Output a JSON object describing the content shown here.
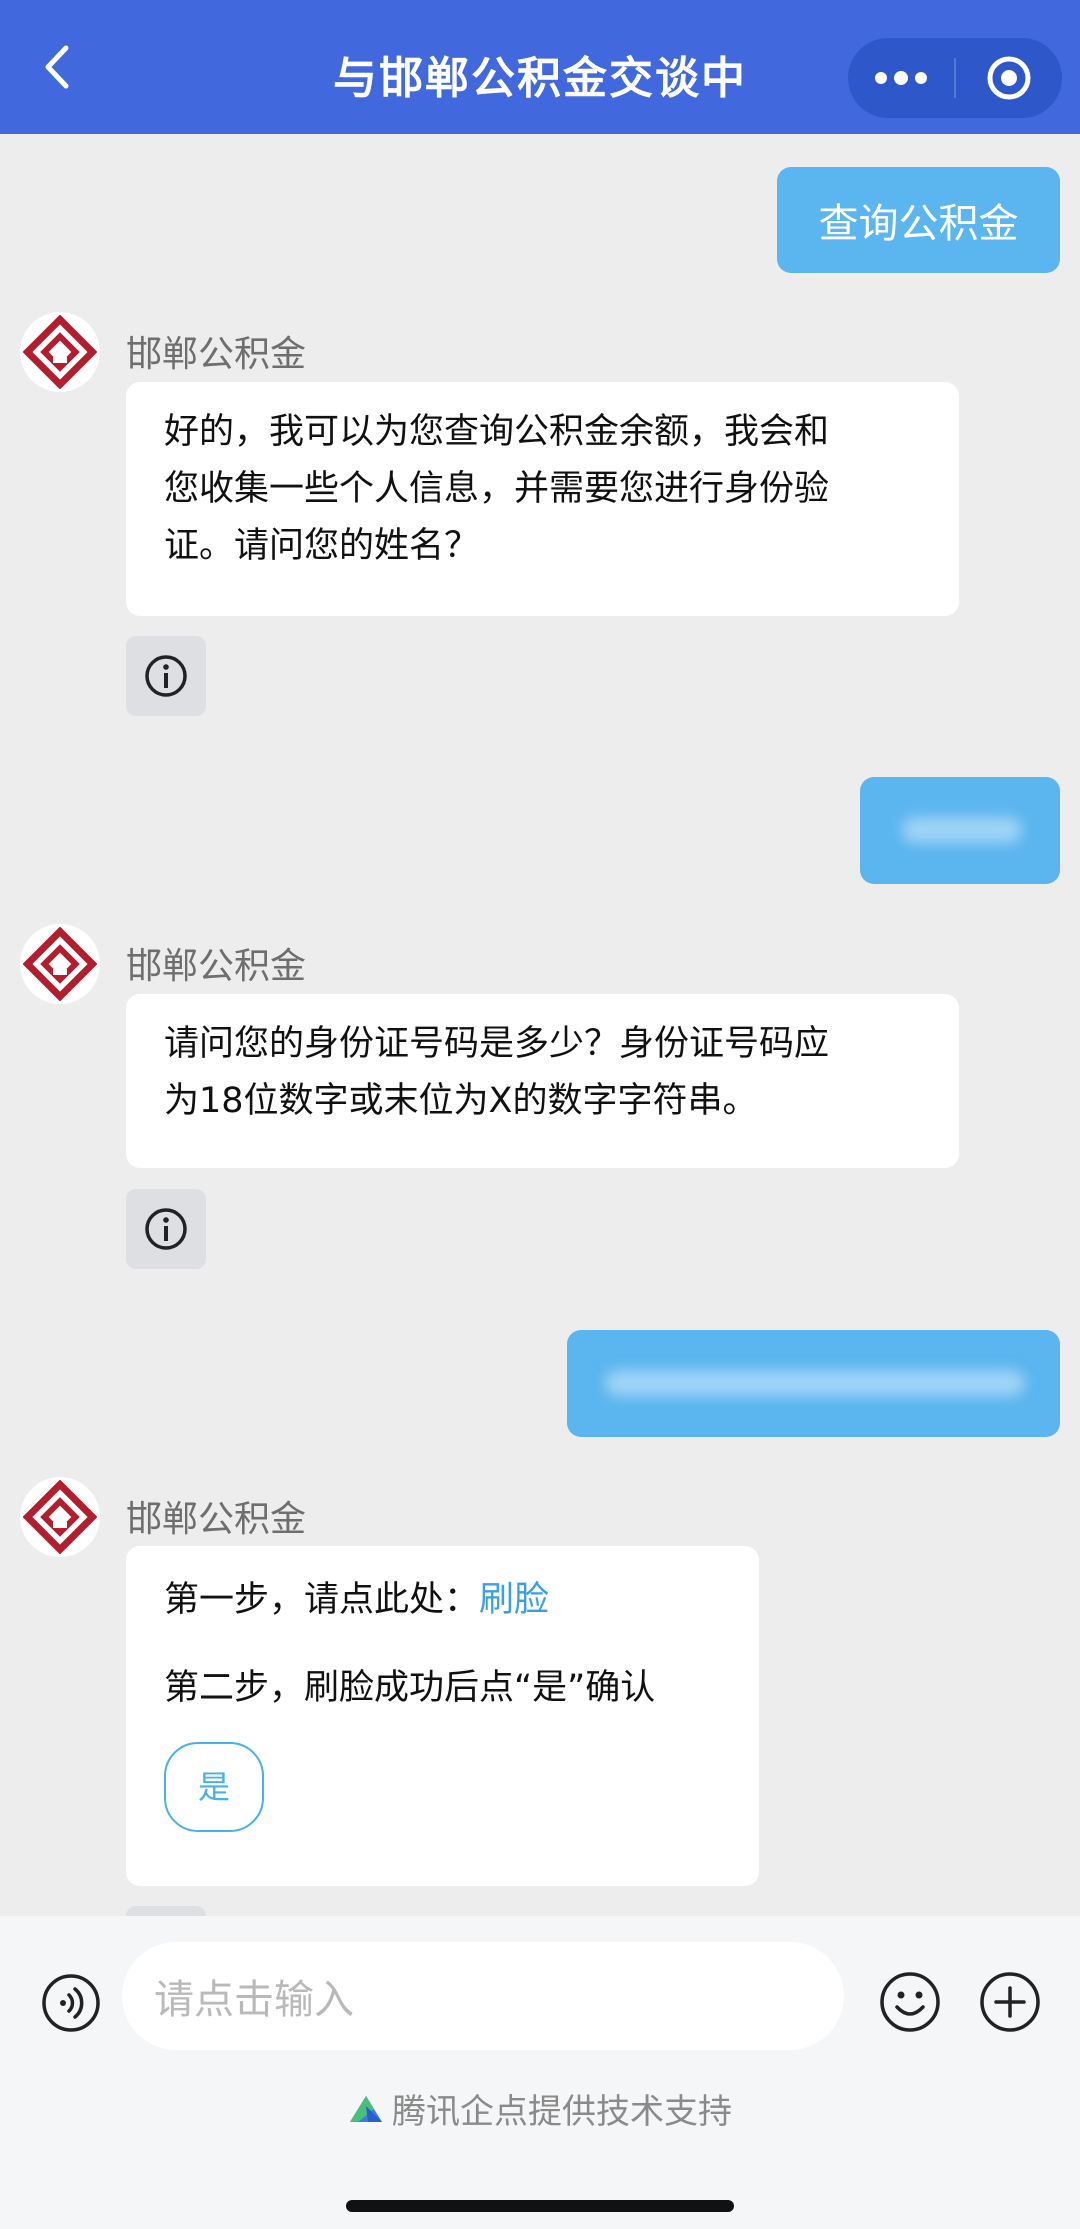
{
  "header": {
    "title": "与邯郸公积金交谈中",
    "back_icon": "chevron-left-icon",
    "more_icon": "more-dots-icon",
    "target_icon": "target-circle-icon"
  },
  "messages": {
    "user_first": "查询公积金",
    "bot_1": {
      "sender": "邯郸公积金",
      "lines": [
        "好的，我可以为您查询公积金余额，我会和",
        "您收集一些个人信息，并需要您进行身份验",
        "证。请问您的姓名？"
      ]
    },
    "bot_2": {
      "sender": "邯郸公积金",
      "lines": [
        "请问您的身份证号码是多少？身份证号码应",
        "为18位数字或末位为X的数字字符串。"
      ]
    },
    "bot_3": {
      "sender": "邯郸公积金",
      "step1_prefix": "第一步，请点此处：",
      "step1_link": "刷脸",
      "step2": "第二步，刷脸成功后点“是”确认",
      "yes_label": "是"
    }
  },
  "input_bar": {
    "placeholder": "请点击输入",
    "voice_icon": "voice-icon",
    "emoji_icon": "emoji-icon",
    "plus_icon": "plus-icon"
  },
  "footer": {
    "credit": "腾讯企点提供技术支持"
  },
  "colors": {
    "header": "#4169dd",
    "user_bubble": "#5bb5ef",
    "logo_red": "#b31e2f",
    "link": "#3aa0e6"
  }
}
